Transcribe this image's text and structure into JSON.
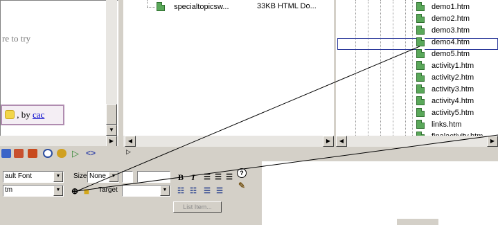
{
  "design_view": {
    "visible_text": "re to try",
    "selection_suffix": ", by ",
    "selection_link": "cac"
  },
  "file_list": {
    "row": {
      "name": "specialtopicsw...",
      "details": "33KB HTML Do..."
    }
  },
  "site_tree": {
    "files": [
      "demo1.htm",
      "demo2.htm",
      "demo3.htm",
      "demo4.htm",
      "demo5.htm",
      "activity1.htm",
      "activity2.htm",
      "activity3.htm",
      "activity4.htm",
      "activity5.htm",
      "links.htm",
      "finalactivity.htm"
    ],
    "highlighted": "demo4.htm"
  },
  "properties": {
    "font_value": "ault Font",
    "size_label": "Size",
    "size_value": "None",
    "format_value": "tm",
    "target_label": "Target",
    "bold_label": "B",
    "italic_label": "I",
    "list_item_button": "List Item..."
  },
  "icons": [
    "file-html-icon",
    "point-to-file-icon",
    "browse-folder-icon",
    "help-icon",
    "edit-icon",
    "align-left-icon",
    "align-center-icon",
    "align-right-icon",
    "unordered-list-icon",
    "ordered-list-icon",
    "outdent-icon",
    "indent-icon"
  ],
  "colors": {
    "accent_link": "#0000cc",
    "selection_border": "#b08cb0",
    "file_icon": "#5aa85a",
    "highlight_box": "#2d3a9b"
  }
}
